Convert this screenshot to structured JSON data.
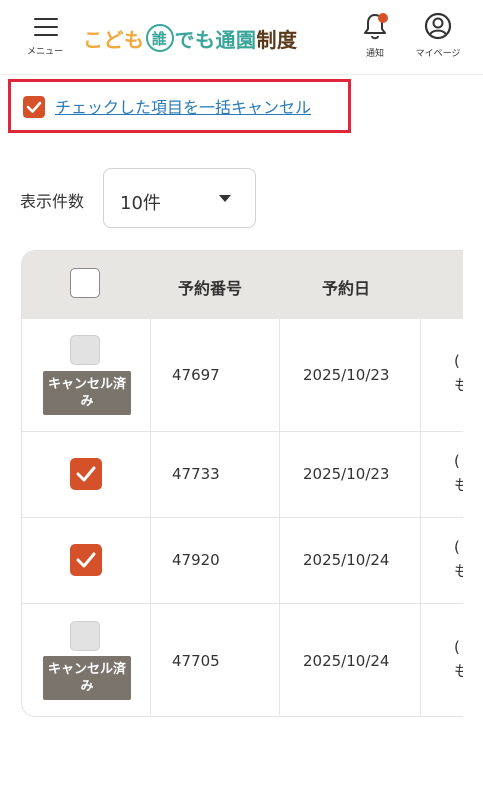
{
  "header": {
    "menu_label": "メニュー",
    "logo": {
      "part1": "こども",
      "circle": "誰",
      "part2": "でも",
      "part3": "通園",
      "part4": "制度"
    },
    "notify_label": "通知",
    "mypage_label": "マイページ",
    "notify_dot_color": "#d4512a"
  },
  "bulk_cancel": {
    "link_text": "チェックした項目を一括キャンセル",
    "checked": true
  },
  "display_count": {
    "label": "表示件数",
    "selected": "10件"
  },
  "table": {
    "columns": [
      "予約番号",
      "予約日"
    ],
    "rows": [
      {
        "number": "47697",
        "date": "2025/10/23",
        "state": "cancelled",
        "badge": "キャンセル済み",
        "extra": [
          "(",
          "も"
        ]
      },
      {
        "number": "47733",
        "date": "2025/10/23",
        "state": "checked",
        "extra": [
          "(",
          "も"
        ]
      },
      {
        "number": "47920",
        "date": "2025/10/24",
        "state": "checked",
        "extra": [
          "(",
          "も"
        ]
      },
      {
        "number": "47705",
        "date": "2025/10/24",
        "state": "cancelled",
        "badge": "キャンセル済み",
        "extra": [
          "(",
          "も"
        ]
      }
    ]
  },
  "colors": {
    "accent": "#d4512a",
    "highlight_border": "#e0263a",
    "link": "#2a7ab5",
    "badge_bg": "#7b746d"
  }
}
